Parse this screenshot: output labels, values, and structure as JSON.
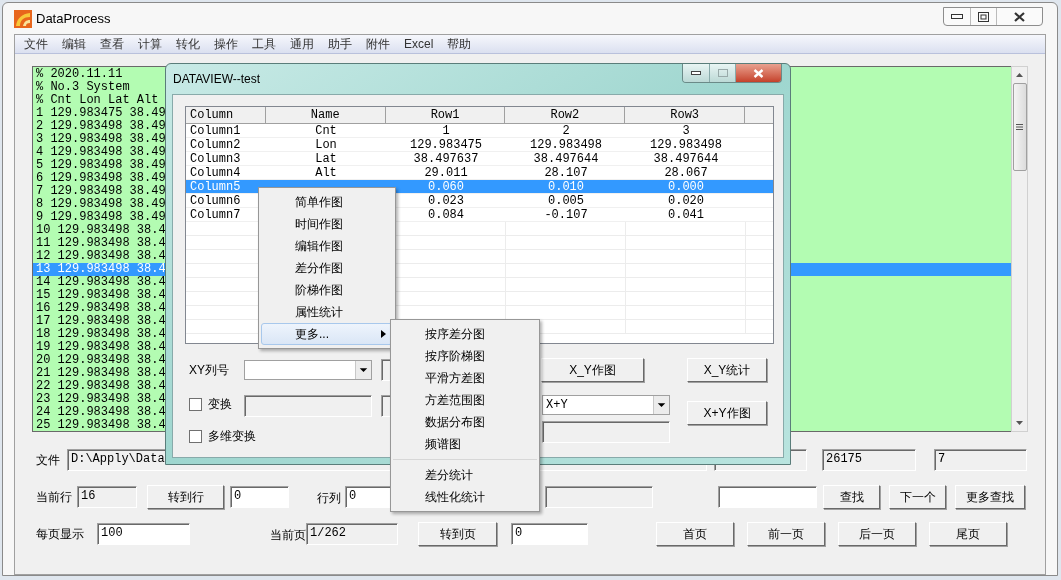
{
  "window": {
    "title": "DataProcess"
  },
  "menu": [
    "文件",
    "编辑",
    "查看",
    "计算",
    "转化",
    "操作",
    "工具",
    "通用",
    "助手",
    "附件",
    "Excel",
    "帮助"
  ],
  "text_view": {
    "lines": [
      {
        "text": "% 2020.11.11",
        "selected": false
      },
      {
        "text": "% No.3 System",
        "selected": false
      },
      {
        "text": "% Cnt Lon Lat Alt",
        "selected": false
      },
      {
        "text": "1 129.983475 38.49",
        "selected": false
      },
      {
        "text": "2 129.983498 38.49",
        "selected": false
      },
      {
        "text": "3 129.983498 38.49",
        "selected": false
      },
      {
        "text": "4 129.983498 38.49",
        "selected": false
      },
      {
        "text": "5 129.983498 38.49",
        "selected": false
      },
      {
        "text": "6 129.983498 38.49",
        "selected": false
      },
      {
        "text": "7 129.983498 38.49",
        "selected": false
      },
      {
        "text": "8 129.983498 38.49",
        "selected": false
      },
      {
        "text": "9 129.983498 38.49",
        "selected": false
      },
      {
        "text": "10 129.983498 38.4",
        "selected": false
      },
      {
        "text": "11 129.983498 38.4",
        "selected": false
      },
      {
        "text": "12 129.983498 38.4",
        "selected": false
      },
      {
        "text": "13 129.983498 38.4",
        "selected": true
      },
      {
        "text": "14 129.983498 38.4",
        "selected": false
      },
      {
        "text": "15 129.983498 38.4",
        "selected": false
      },
      {
        "text": "16 129.983498 38.4",
        "selected": false
      },
      {
        "text": "17 129.983498 38.4",
        "selected": false
      },
      {
        "text": "18 129.983498 38.4",
        "selected": false
      },
      {
        "text": "19 129.983498 38.4",
        "selected": false
      },
      {
        "text": "20 129.983498 38.4",
        "selected": false
      },
      {
        "text": "21 129.983498 38.4",
        "selected": false
      },
      {
        "text": "22 129.983498 38.4",
        "selected": false
      },
      {
        "text": "23 129.983498 38.4",
        "selected": false
      },
      {
        "text": "24 129.983498 38.4",
        "selected": false
      },
      {
        "text": "25 129.983498 38.4",
        "selected": false
      }
    ]
  },
  "file_row": {
    "label": "文件",
    "path": "D:\\Apply\\Data",
    "count": "26175",
    "columns": "7"
  },
  "current_row": {
    "label": "当前行",
    "value": "16",
    "goto_button": "转到行",
    "goto_value": "0",
    "row_col_label": "行列",
    "row_col_value": "0"
  },
  "search": {
    "buttons": [
      "查找",
      "下一个",
      "更多查找"
    ]
  },
  "paging": {
    "label": "每页显示",
    "value": "100",
    "page_label": "当前页",
    "page_value": "1/262",
    "goto_button": "转到页",
    "goto_value": "0",
    "buttons": [
      "首页",
      "前一页",
      "后一页",
      "尾页"
    ]
  },
  "dialog": {
    "title": "DATAVIEW--test",
    "table": {
      "columns": [
        "Column",
        "Name",
        "Row1",
        "Row2",
        "Row3"
      ],
      "rows": [
        {
          "column": "Column1",
          "name": "Cnt",
          "values": [
            "1",
            "2",
            "3"
          ],
          "selected": false
        },
        {
          "column": "Column2",
          "name": "Lon",
          "values": [
            "129.983475",
            "129.983498",
            "129.983498"
          ],
          "selected": false
        },
        {
          "column": "Column3",
          "name": "Lat",
          "values": [
            "38.497637",
            "38.497644",
            "38.497644"
          ],
          "selected": false
        },
        {
          "column": "Column4",
          "name": "Alt",
          "values": [
            "29.011",
            "28.107",
            "28.067"
          ],
          "selected": false
        },
        {
          "column": "Column5",
          "values": [
            "0.060",
            "0.010",
            "0.000"
          ],
          "selected": true
        },
        {
          "column": "Column6",
          "values": [
            "0.023",
            "0.005",
            "0.020"
          ],
          "selected": false
        },
        {
          "column": "Column7",
          "values": [
            "0.084",
            "-0.107",
            "0.041"
          ],
          "selected": false
        }
      ]
    },
    "xy_label": "XY列号",
    "xy_plot_button": "X_Y作图",
    "xy_stat_button": "X_Y统计",
    "transform": {
      "label": "变换",
      "checked": false
    },
    "multi_transform": {
      "label": "多维变换",
      "checked": false
    },
    "op_combo": "X+Y",
    "op_button": "X+Y作图"
  },
  "context_menu": {
    "items": [
      {
        "label": "简单作图",
        "selected": false,
        "submenu": false
      },
      {
        "label": "时间作图",
        "selected": false,
        "submenu": false
      },
      {
        "label": "编辑作图",
        "selected": false,
        "submenu": false
      },
      {
        "label": "差分作图",
        "selected": false,
        "submenu": false
      },
      {
        "label": "阶梯作图",
        "selected": false,
        "submenu": false
      },
      {
        "label": "属性统计",
        "selected": false,
        "submenu": false
      },
      {
        "label": "更多...",
        "selected": true,
        "submenu": true
      }
    ]
  },
  "submenu": {
    "groups": [
      [
        "按序差分图",
        "按序阶梯图",
        "平滑方差图",
        "方差范围图",
        "数据分布图",
        "频谱图"
      ],
      [
        "差分统计",
        "线性化统计"
      ]
    ]
  }
}
